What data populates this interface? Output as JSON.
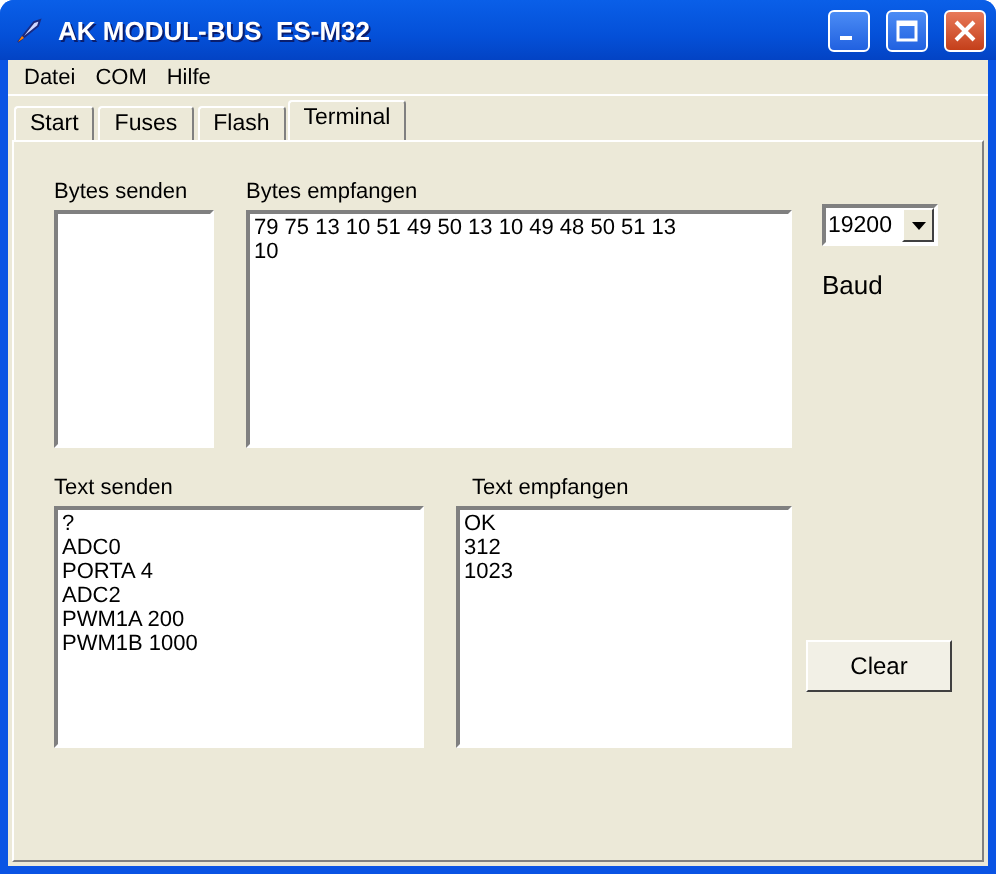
{
  "window": {
    "title": "AK MODUL-BUS  ES-M32"
  },
  "menu": [
    "Datei",
    "COM",
    "Hilfe"
  ],
  "tabs": [
    {
      "label": "Start",
      "selected": false
    },
    {
      "label": "Fuses",
      "selected": false
    },
    {
      "label": "Flash",
      "selected": false
    },
    {
      "label": "Terminal",
      "selected": true
    }
  ],
  "bytes_send": {
    "label": "Bytes senden"
  },
  "bytes_received": {
    "label": "Bytes empfangen",
    "lines": [
      "79 75 13 10 51 49 50 13 10 49 48 50 51 13",
      "10"
    ]
  },
  "baud": {
    "value": "19200",
    "label": "Baud"
  },
  "text_send": {
    "label": "Text senden",
    "lines": [
      "?",
      "ADC0",
      "PORTA 4",
      "ADC2",
      "PWM1A 200",
      "PWM1B 1000"
    ]
  },
  "text_received": {
    "label": "Text empfangen",
    "lines": [
      "OK",
      "312",
      "1023"
    ]
  },
  "buttons": [
    "Clear"
  ]
}
